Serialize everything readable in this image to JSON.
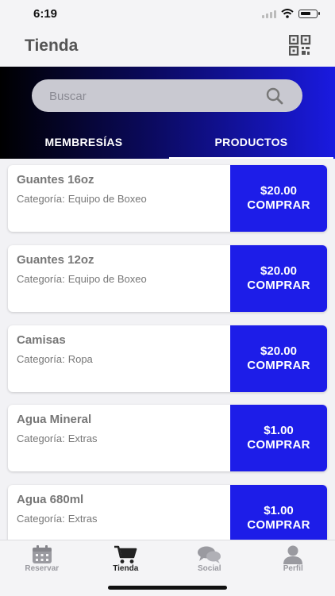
{
  "status_bar": {
    "time": "6:19"
  },
  "header": {
    "title": "Tienda",
    "qr_icon": "qr-code-icon"
  },
  "search": {
    "placeholder": "Buscar",
    "value": ""
  },
  "tabs": [
    {
      "label": "MEMBRESÍAS",
      "active": false
    },
    {
      "label": "PRODUCTOS",
      "active": true
    }
  ],
  "category_prefix": "Categoría:",
  "products": [
    {
      "name": "Guantes 16oz",
      "category": "Equipo de Boxeo",
      "price": "$20.00",
      "action": "COMPRAR"
    },
    {
      "name": "Guantes 12oz",
      "category": "Equipo de Boxeo",
      "price": "$20.00",
      "action": "COMPRAR"
    },
    {
      "name": "Camisas",
      "category": "Ropa",
      "price": "$20.00",
      "action": "COMPRAR"
    },
    {
      "name": "Agua Mineral",
      "category": "Extras",
      "price": "$1.00",
      "action": "COMPRAR"
    },
    {
      "name": "Agua 680ml",
      "category": "Extras",
      "price": "$1.00",
      "action": "COMPRAR"
    }
  ],
  "tab_bar": [
    {
      "label": "Reservar",
      "icon": "calendar-icon",
      "active": false
    },
    {
      "label": "Tienda",
      "icon": "cart-icon",
      "active": true
    },
    {
      "label": "Social",
      "icon": "chat-icon",
      "active": false
    },
    {
      "label": "Perfil",
      "icon": "user-icon",
      "active": false
    }
  ],
  "colors": {
    "accent": "#1d1de8",
    "gradient_start": "#000000",
    "gradient_end": "#1a1ae0"
  }
}
